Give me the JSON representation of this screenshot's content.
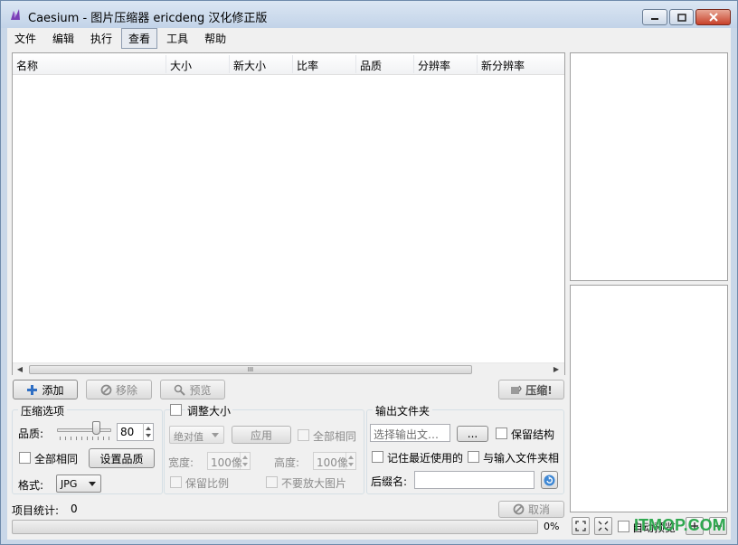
{
  "window": {
    "title": "Caesium - 图片压缩器  ericdeng 汉化修正版"
  },
  "menu": [
    "文件",
    "编辑",
    "执行",
    "查看",
    "工具",
    "帮助"
  ],
  "file_list": {
    "columns": [
      "名称",
      "大小",
      "新大小",
      "比率",
      "品质",
      "分辨率",
      "新分辨率"
    ],
    "scroll_grip": "III"
  },
  "actions": {
    "add": "添加",
    "remove": "移除",
    "preview": "预览",
    "compress": "压缩!"
  },
  "compression": {
    "group_title": "压缩选项",
    "quality_label": "品质:",
    "quality_value": "80",
    "quality_level": 80,
    "all_same_label": "全部相同",
    "set_quality_button": "设置品质",
    "format_label": "格式:",
    "format_value": "JPG"
  },
  "resize": {
    "group_title": "调整大小",
    "mode_value": "绝对值",
    "apply_button": "应用",
    "all_same_label": "全部相同",
    "width_label": "宽度:",
    "width_value": "100像",
    "height_label": "高度:",
    "height_value": "100像",
    "keep_ratio_label": "保留比例",
    "no_enlarge_label": "不要放大图片"
  },
  "output": {
    "group_title": "输出文件夹",
    "folder_placeholder": "选择输出文…",
    "browse_button": "...",
    "keep_structure_label": "保留结构",
    "remember_last_label": "记住最近使用的",
    "same_as_input_label": "与输入文件夹相",
    "suffix_label": "后缀名:",
    "suffix_value": ""
  },
  "status": {
    "item_stats_label": "项目统计:",
    "item_count": "0",
    "cancel_button": "取消",
    "progress_text": "0%",
    "progress_value": 0
  },
  "preview_tools": {
    "auto_preview_label": "自动预览"
  },
  "watermark": "ITMOP.COM",
  "colors": {
    "progress_green": "#3cb043",
    "watermark_green": "#2fa84f"
  }
}
